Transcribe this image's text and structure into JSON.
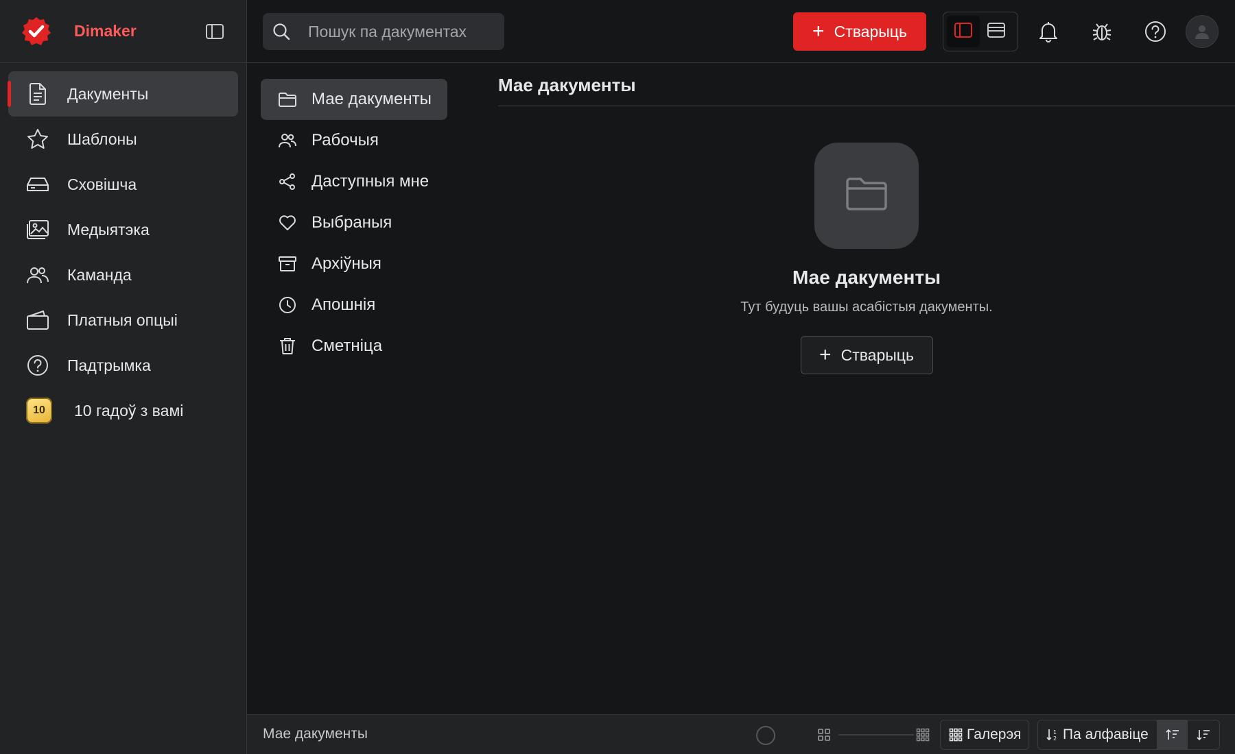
{
  "brand": {
    "name": "Dimaker",
    "accent": "#e02424"
  },
  "sidebar": {
    "items": [
      {
        "label": "Дакументы",
        "icon": "document-icon",
        "active": true
      },
      {
        "label": "Шаблоны",
        "icon": "star-icon"
      },
      {
        "label": "Сховішча",
        "icon": "storage-drive-icon"
      },
      {
        "label": "Медыятэка",
        "icon": "image-gallery-icon"
      },
      {
        "label": "Каманда",
        "icon": "team-icon"
      },
      {
        "label": "Платныя опцыі",
        "icon": "wallet-icon"
      },
      {
        "label": "Падтрымка",
        "icon": "help-icon"
      }
    ],
    "anniversary": {
      "badge": "10",
      "label": "10 гадоў з вамі"
    }
  },
  "topbar": {
    "search_placeholder": "Пошук па дакументах",
    "create_label": "Стварыць",
    "icons": [
      "notification-bell-icon",
      "bug-report-icon",
      "help-icon",
      "user-avatar-icon"
    ]
  },
  "subnav": {
    "items": [
      {
        "label": "Мае дакументы",
        "icon": "folder-icon",
        "active": true
      },
      {
        "label": "Рабочыя",
        "icon": "users-icon"
      },
      {
        "label": "Даступныя мне",
        "icon": "share-icon"
      },
      {
        "label": "Выбраныя",
        "icon": "heart-icon"
      },
      {
        "label": "Архіўныя",
        "icon": "archive-icon"
      },
      {
        "label": "Апошнія",
        "icon": "clock-icon"
      },
      {
        "label": "Сметніца",
        "icon": "trash-icon"
      }
    ]
  },
  "main": {
    "title": "Мае дакументы",
    "empty": {
      "title": "Мае дакументы",
      "subtitle": "Тут будуць вашы асабістыя дакументы.",
      "button": "Стварыць"
    }
  },
  "bottombar": {
    "label": "Мае дакументы",
    "view_label": "Галерэя",
    "sort_label": "Па алфавіце"
  }
}
